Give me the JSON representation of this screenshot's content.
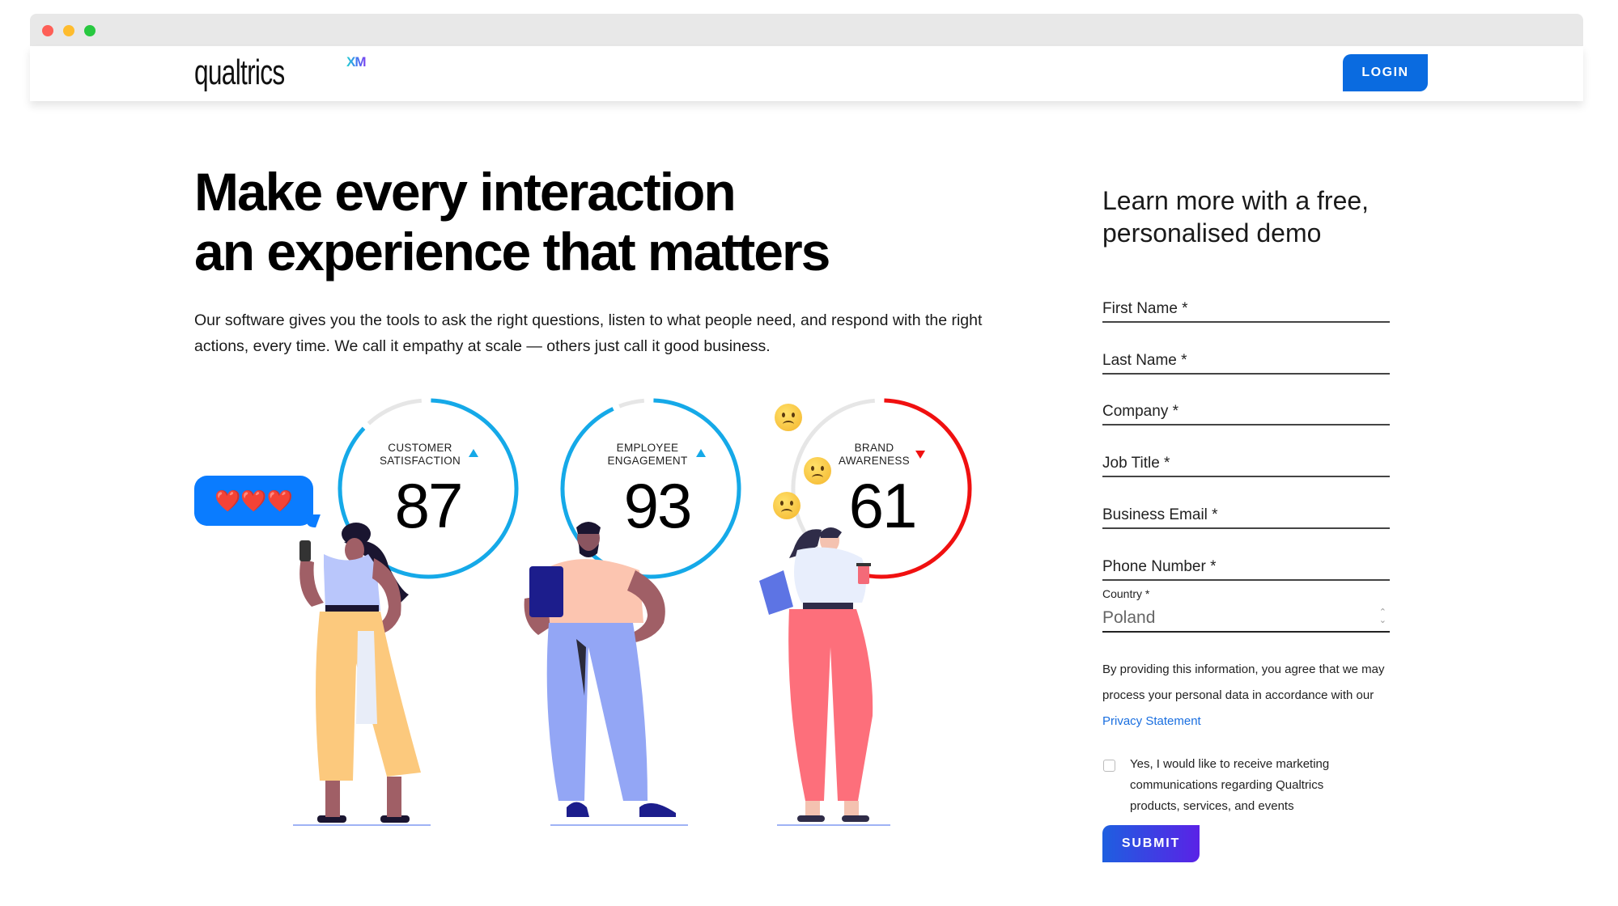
{
  "window": {
    "traffic_lights": [
      "close",
      "minimize",
      "maximize"
    ]
  },
  "header": {
    "logo_text": "qualtrics",
    "logo_superscript": "XM",
    "login_label": "LOGIN"
  },
  "hero": {
    "title_line1": "Make every interaction",
    "title_line2": "an experience that matters",
    "body": "Our software gives you the tools to ask the right questions, listen to what people need, and respond with the right actions, every time. We call it empathy at scale — others just call it good business."
  },
  "illustration": {
    "bubble_text": "❤️❤️❤️",
    "gauges": [
      {
        "label_line1": "CUSTOMER",
        "label_line2": "SATISFACTION",
        "value": "87",
        "score": 87,
        "trend": "up",
        "color": "#15a9e8"
      },
      {
        "label_line1": "EMPLOYEE",
        "label_line2": "ENGAGEMENT",
        "value": "93",
        "score": 93,
        "trend": "up",
        "color": "#15a9e8"
      },
      {
        "label_line1": "BRAND",
        "label_line2": "AWARENESS",
        "value": "61",
        "score": 61,
        "trend": "down",
        "color": "#f01010"
      }
    ],
    "emoji_count": 3,
    "emoji": "frowning-face"
  },
  "form": {
    "title": "Learn more with a free, personalised demo",
    "fields": [
      {
        "name": "first-name",
        "placeholder": "First Name *",
        "value": ""
      },
      {
        "name": "last-name",
        "placeholder": "Last Name *",
        "value": ""
      },
      {
        "name": "company",
        "placeholder": "Company *",
        "value": ""
      },
      {
        "name": "job-title",
        "placeholder": "Job Title *",
        "value": ""
      },
      {
        "name": "business-email",
        "placeholder": "Business Email *",
        "value": ""
      },
      {
        "name": "phone-number",
        "placeholder": "Phone Number *",
        "value": ""
      }
    ],
    "country_label": "Country *",
    "country_value": "Poland",
    "consent_text": "By providing this information, you agree that we may process your personal data in accordance with our ",
    "privacy_link": "Privacy Statement",
    "marketing_checkbox_label": "Yes, I would like to receive marketing communications regarding Qualtrics products, services, and events",
    "marketing_checked": false,
    "submit_label": "SUBMIT"
  },
  "colors": {
    "login_blue": "#0a6be0",
    "gauge_blue": "#15a9e8",
    "gauge_red": "#f01010",
    "link_blue": "#1a6fe0",
    "submit_gradient_start": "#1e5fe0",
    "submit_gradient_end": "#5a22e6"
  }
}
